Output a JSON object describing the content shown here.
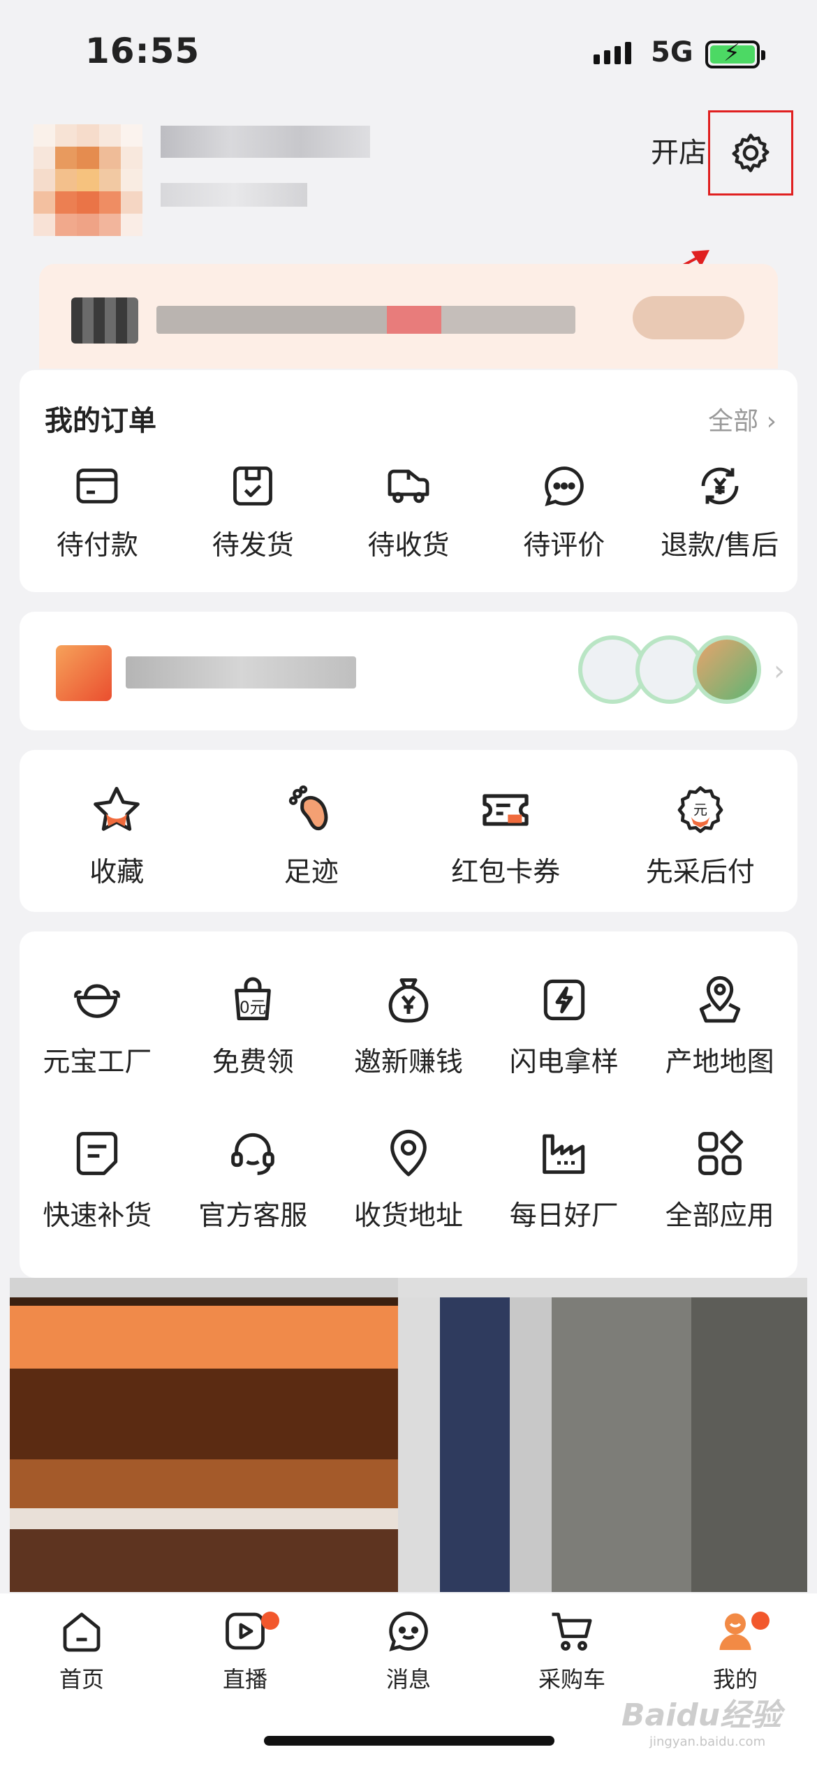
{
  "status_bar": {
    "time": "16:55",
    "network": "5G"
  },
  "header": {
    "open_shop_label": "开店"
  },
  "orders": {
    "title": "我的订单",
    "view_all_label": "全部",
    "items": [
      {
        "label": "待付款",
        "icon": "card-icon"
      },
      {
        "label": "待发货",
        "icon": "box-check-icon"
      },
      {
        "label": "待收货",
        "icon": "truck-icon"
      },
      {
        "label": "待评价",
        "icon": "chat-dots-icon"
      },
      {
        "label": "退款/售后",
        "icon": "yen-refund-icon"
      }
    ]
  },
  "tools": {
    "items": [
      {
        "label": "收藏",
        "icon": "star-icon"
      },
      {
        "label": "足迹",
        "icon": "footprint-icon"
      },
      {
        "label": "红包卡券",
        "icon": "coupon-icon"
      },
      {
        "label": "先采后付",
        "icon": "shield-yuan-icon"
      }
    ]
  },
  "apps": {
    "row1": [
      {
        "label": "元宝工厂",
        "icon": "ingot-icon"
      },
      {
        "label": "免费领",
        "icon": "free-bag-icon"
      },
      {
        "label": "邀新赚钱",
        "icon": "money-bag-icon"
      },
      {
        "label": "闪电拿样",
        "icon": "lightning-icon"
      },
      {
        "label": "产地地图",
        "icon": "map-pin-icon"
      }
    ],
    "row2": [
      {
        "label": "快速补货",
        "icon": "note-icon"
      },
      {
        "label": "官方客服",
        "icon": "headset-icon"
      },
      {
        "label": "收货地址",
        "icon": "location-icon"
      },
      {
        "label": "每日好厂",
        "icon": "factory-icon"
      },
      {
        "label": "全部应用",
        "icon": "grid-apps-icon"
      }
    ]
  },
  "tabbar": {
    "tabs": [
      {
        "label": "首页",
        "icon": "home-icon"
      },
      {
        "label": "直播",
        "icon": "live-play-icon"
      },
      {
        "label": "消息",
        "icon": "message-icon"
      },
      {
        "label": "采购车",
        "icon": "cart-icon"
      },
      {
        "label": "我的",
        "icon": "profile-icon"
      }
    ]
  },
  "watermark": {
    "text": "Baidu经验",
    "sub": "jingyan.baidu.com"
  },
  "colors": {
    "accent": "#f2572c",
    "highlight_box": "#e02020"
  }
}
